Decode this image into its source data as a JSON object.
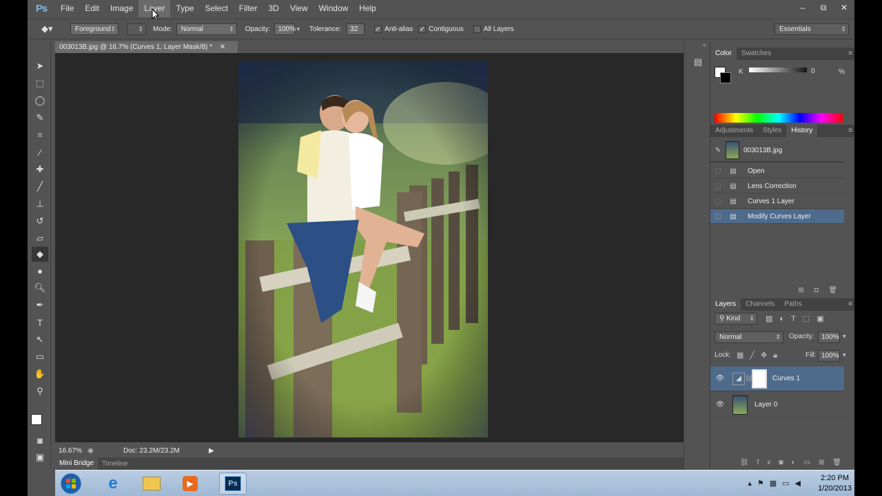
{
  "app": {
    "logo": "Ps"
  },
  "menu": [
    "File",
    "Edit",
    "Image",
    "Layer",
    "Type",
    "Select",
    "Filter",
    "3D",
    "View",
    "Window",
    "Help"
  ],
  "active_menu": "Layer",
  "window_controls": {
    "minimize": "–",
    "maximize": "⧉",
    "close": "✕"
  },
  "options": {
    "foreground": "Foreground",
    "mode_label": "Mode:",
    "mode_value": "Normal",
    "opacity_label": "Opacity:",
    "opacity_value": "100%",
    "tolerance_label": "Tolerance:",
    "tolerance_value": "32",
    "antialias_label": "Anti-alias",
    "antialias_checked": true,
    "contiguous_label": "Contiguous",
    "contiguous_checked": true,
    "alllayers_label": "All Layers",
    "alllayers_checked": false,
    "workspace": "Essentials"
  },
  "document": {
    "tab_title": "003013B.jpg @ 16.7% (Curves 1, Layer Mask/8) *",
    "zoom": "16.67%",
    "doc_size": "Doc: 23.2M/23.2M"
  },
  "bottom_tabs": [
    "Mini Bridge",
    "Timeline"
  ],
  "color_panel": {
    "tabs": [
      "Color",
      "Swatches"
    ],
    "channel": "K",
    "value": "0",
    "unit": "%"
  },
  "history_panel": {
    "tabs": [
      "Adjustments",
      "Styles",
      "History"
    ],
    "snapshot": "003013B.jpg",
    "items": [
      "Open",
      "Lens Correction",
      "Curves 1 Layer",
      "Modify Curves Layer"
    ],
    "selected_index": 3
  },
  "layers_panel": {
    "tabs": [
      "Layers",
      "Channels",
      "Paths"
    ],
    "kind": "Kind",
    "blend": "Normal",
    "opacity_label": "Opacity:",
    "opacity_value": "100%",
    "lock_label": "Lock:",
    "fill_label": "Fill:",
    "fill_value": "100%",
    "layers": [
      {
        "name": "Curves 1",
        "selected": true
      },
      {
        "name": "Layer 0",
        "selected": false
      }
    ]
  },
  "taskbar": {
    "time": "2:20 PM",
    "date": "1/20/2013"
  },
  "colors": {
    "accent": "#4f6b8c",
    "ps_blue": "#7ab7e8",
    "canvas": "#282828",
    "panel": "#535353"
  }
}
